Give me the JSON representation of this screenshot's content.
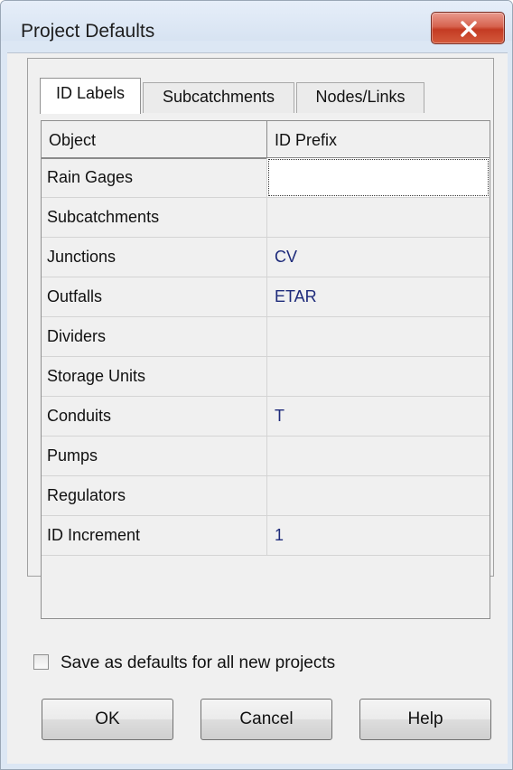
{
  "window": {
    "title": "Project Defaults",
    "close_icon": "close-x-icon"
  },
  "tabs": [
    {
      "label": "ID Labels",
      "active": true
    },
    {
      "label": "Subcatchments",
      "active": false
    },
    {
      "label": "Nodes/Links",
      "active": false
    }
  ],
  "grid": {
    "headers": [
      "Object",
      "ID Prefix"
    ],
    "rows": [
      {
        "object": "Rain Gages",
        "value": ""
      },
      {
        "object": "Subcatchments",
        "value": ""
      },
      {
        "object": "Junctions",
        "value": "CV"
      },
      {
        "object": "Outfalls",
        "value": "ETAR"
      },
      {
        "object": "Dividers",
        "value": ""
      },
      {
        "object": "Storage Units",
        "value": ""
      },
      {
        "object": "Conduits",
        "value": "T"
      },
      {
        "object": "Pumps",
        "value": ""
      },
      {
        "object": "Regulators",
        "value": ""
      },
      {
        "object": "ID Increment",
        "value": "1"
      }
    ]
  },
  "save_defaults": {
    "label": "Save as defaults for all new projects",
    "checked": false
  },
  "buttons": {
    "ok": "OK",
    "cancel": "Cancel",
    "help": "Help"
  },
  "colors": {
    "value_text": "#1d2a7a",
    "close_button": "#c43b23"
  }
}
